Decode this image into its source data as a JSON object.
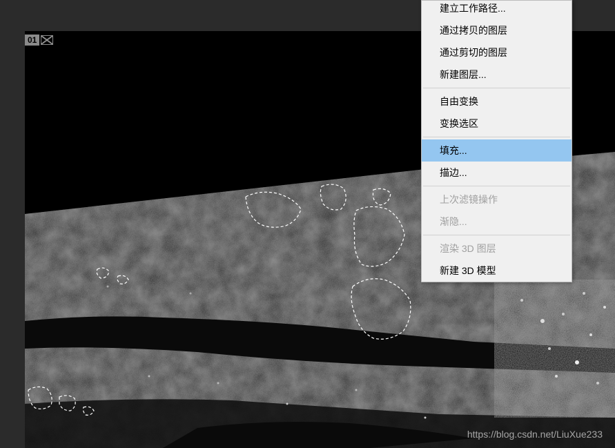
{
  "tab": {
    "number": "01"
  },
  "context_menu": {
    "items": [
      {
        "label": "建立工作路径...",
        "partial_top": true
      },
      {
        "label": "通过拷贝的图层"
      },
      {
        "label": "通过剪切的图层"
      },
      {
        "label": "新建图层..."
      },
      {
        "separator": true
      },
      {
        "label": "自由变换"
      },
      {
        "label": "变换选区"
      },
      {
        "separator": true
      },
      {
        "label": "填充...",
        "selected": true
      },
      {
        "label": "描边..."
      },
      {
        "separator": true
      },
      {
        "label": "上次滤镜操作",
        "disabled": true
      },
      {
        "label": "渐隐...",
        "disabled": true
      },
      {
        "separator": true
      },
      {
        "label": "渲染 3D 图层",
        "disabled": true
      },
      {
        "label": "新建 3D 模型"
      }
    ]
  },
  "watermark": {
    "text": "https://blog.csdn.net/LiuXue233"
  }
}
